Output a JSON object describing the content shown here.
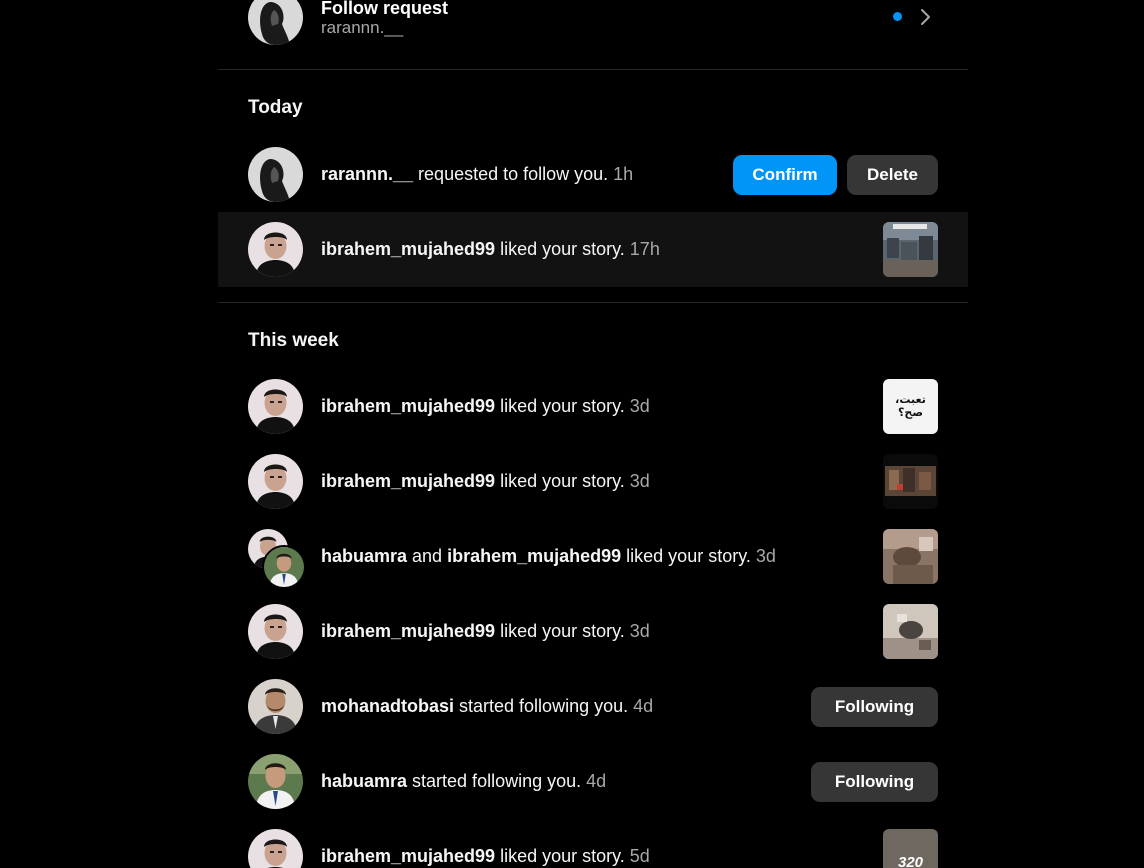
{
  "follow_request": {
    "title": "Follow request",
    "username": "rarannn.__",
    "unread_color": "#0095f6",
    "arrow_icon": "chevron-right-icon"
  },
  "today": {
    "title": "Today",
    "items": [
      {
        "user": "rarannn.__",
        "text": " requested to follow you. ",
        "time": "1h",
        "confirm_label": "Confirm",
        "delete_label": "Delete"
      },
      {
        "user": "ibrahem_mujahed99",
        "text": " liked your story. ",
        "time": "17h"
      }
    ]
  },
  "this_week": {
    "title": "This week",
    "items": [
      {
        "user": "ibrahem_mujahed99",
        "text": " liked your story. ",
        "time": "3d",
        "thumb_caption": "تعبت، صح؟"
      },
      {
        "user": "ibrahem_mujahed99",
        "text": " liked your story. ",
        "time": "3d"
      },
      {
        "user": "habuamra",
        "and": " and ",
        "user2": "ibrahem_mujahed99",
        "text": " liked your story. ",
        "time": "3d"
      },
      {
        "user": "ibrahem_mujahed99",
        "text": " liked your story. ",
        "time": "3d"
      },
      {
        "user": "mohanadtobasi",
        "text": " started following you. ",
        "time": "4d",
        "button_label": "Following"
      },
      {
        "user": "habuamra",
        "text": " started following you. ",
        "time": "4d",
        "button_label": "Following"
      },
      {
        "user": "ibrahem_mujahed99",
        "text": " liked your story. ",
        "time": "5d",
        "thumb_caption": "320"
      }
    ]
  },
  "colors": {
    "background": "#000000",
    "primary_button": "#0095f6",
    "secondary_button": "#363636",
    "muted_text": "#a8a8a8",
    "highlight_row": "#121212"
  }
}
